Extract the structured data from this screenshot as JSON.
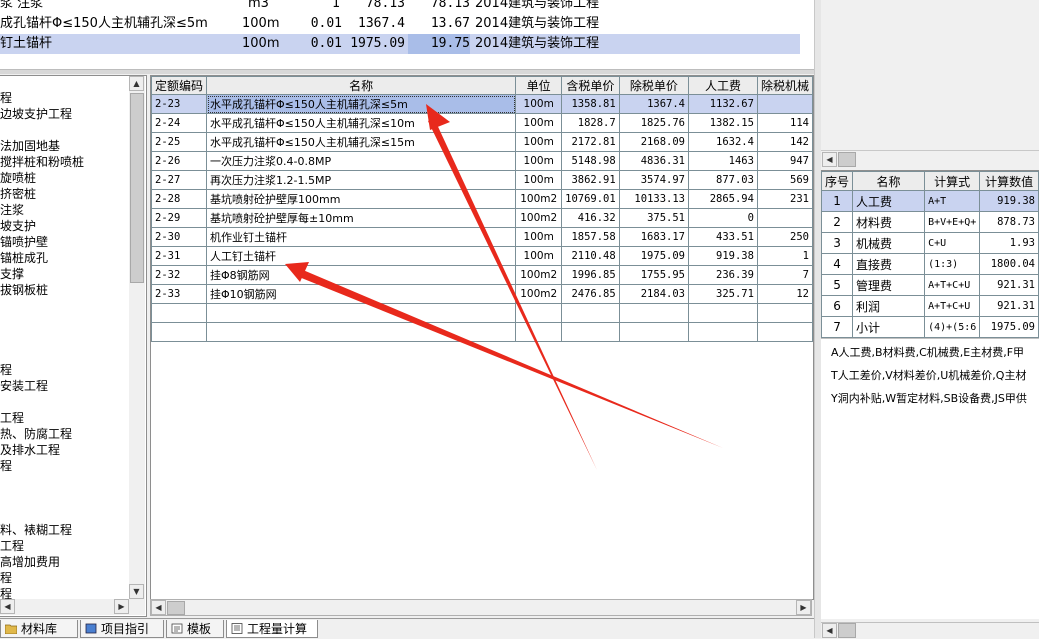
{
  "top_rows": [
    {
      "name": "浆 注浆",
      "unit": "m3",
      "qty": "1",
      "unit_price": "78.13",
      "total": "78.13",
      "profession": "2014建筑与装饰工程"
    },
    {
      "name": "成孔锚杆Φ≤150人主机辅孔深≤5m",
      "unit": "100m",
      "qty": "0.01",
      "unit_price": "1367.4",
      "total": "13.67",
      "profession": "2014建筑与装饰工程"
    },
    {
      "name": "钉土锚杆",
      "unit": "100m",
      "qty": "0.01",
      "unit_price": "1975.09",
      "total": "19.75",
      "profession": "2014建筑与装饰工程"
    }
  ],
  "tree_items": [
    "程",
    "边坡支护工程",
    "",
    "法加固地基",
    "搅拌桩和粉喷桩",
    "旋喷桩",
    "挤密桩",
    "注浆",
    "坡支护",
    "锚喷护壁",
    "锚桩成孔",
    "支撑",
    "拔钢板桩",
    "",
    "",
    "",
    "",
    "程",
    "安装工程",
    "",
    "工程",
    "热、防腐工程",
    "及排水工程",
    "程",
    "",
    "",
    "",
    "料、裱糊工程",
    "工程",
    "高增加费用",
    "程",
    "程"
  ],
  "main_grid": {
    "headers": [
      "定额编码",
      "名称",
      "单位",
      "含税单价",
      "除税单价",
      "人工费",
      "除税机械"
    ],
    "rows": [
      {
        "code": "2-23",
        "name": "水平成孔锚杆Φ≤150人主机辅孔深≤5m",
        "unit": "100m",
        "tax_price": "1358.81",
        "price": "1367.4",
        "labor": "1132.67",
        "machine": ""
      },
      {
        "code": "2-24",
        "name": "水平成孔锚杆Φ≤150人主机辅孔深≤10m",
        "unit": "100m",
        "tax_price": "1828.7",
        "price": "1825.76",
        "labor": "1382.15",
        "machine": "114"
      },
      {
        "code": "2-25",
        "name": "水平成孔锚杆Φ≤150人主机辅孔深≤15m",
        "unit": "100m",
        "tax_price": "2172.81",
        "price": "2168.09",
        "labor": "1632.4",
        "machine": "142"
      },
      {
        "code": "2-26",
        "name": "一次压力注浆0.4-0.8MP",
        "unit": "100m",
        "tax_price": "5148.98",
        "price": "4836.31",
        "labor": "1463",
        "machine": "947"
      },
      {
        "code": "2-27",
        "name": "再次压力注浆1.2-1.5MP",
        "unit": "100m",
        "tax_price": "3862.91",
        "price": "3574.97",
        "labor": "877.03",
        "machine": "569"
      },
      {
        "code": "2-28",
        "name": "基坑喷射砼护壁厚100mm",
        "unit": "100m2",
        "tax_price": "10769.01",
        "price": "10133.13",
        "labor": "2865.94",
        "machine": "231"
      },
      {
        "code": "2-29",
        "name": "基坑喷射砼护壁厚每±10mm",
        "unit": "100m2",
        "tax_price": "416.32",
        "price": "375.51",
        "labor": "0",
        "machine": ""
      },
      {
        "code": "2-30",
        "name": "机作业钉土锚杆",
        "unit": "100m",
        "tax_price": "1857.58",
        "price": "1683.17",
        "labor": "433.51",
        "machine": "250"
      },
      {
        "code": "2-31",
        "name": "人工钉土锚杆",
        "unit": "100m",
        "tax_price": "2110.48",
        "price": "1975.09",
        "labor": "919.38",
        "machine": "1"
      },
      {
        "code": "2-32",
        "name": "挂Φ8钢筋网",
        "unit": "100m2",
        "tax_price": "1996.85",
        "price": "1755.95",
        "labor": "236.39",
        "machine": "7"
      },
      {
        "code": "2-33",
        "name": "挂Φ10钢筋网",
        "unit": "100m2",
        "tax_price": "2476.85",
        "price": "2184.03",
        "labor": "325.71",
        "machine": "12"
      }
    ]
  },
  "bottom_tabs": [
    {
      "label": "材料库",
      "icon": "folder-icon"
    },
    {
      "label": "项目指引",
      "icon": "book-icon"
    },
    {
      "label": "模板",
      "icon": "template-icon"
    },
    {
      "label": "工程量计算",
      "icon": "calculator-icon"
    }
  ],
  "fee_grid": {
    "headers": [
      "序号",
      "名称",
      "计算式",
      "计算数值"
    ],
    "rows": [
      {
        "no": "1",
        "name": "人工费",
        "formula": "A+T",
        "value": "919.38"
      },
      {
        "no": "2",
        "name": "材料费",
        "formula": "B+V+E+Q+",
        "value": "878.73"
      },
      {
        "no": "3",
        "name": "机械费",
        "formula": "C+U",
        "value": "1.93"
      },
      {
        "no": "4",
        "name": "直接费",
        "formula": "(1:3)",
        "value": "1800.04"
      },
      {
        "no": "5",
        "name": "管理费",
        "formula": "A+T+C+U",
        "value": "921.31"
      },
      {
        "no": "6",
        "name": "利润",
        "formula": "A+T+C+U",
        "value": "921.31"
      },
      {
        "no": "7",
        "name": "小计",
        "formula": "(4)+(5:6",
        "value": "1975.09"
      }
    ]
  },
  "legend_lines": [
    "A人工费,B材料费,C机械费,E主材费,F甲",
    "T人工差价,V材料差价,U机械差价,Q主材",
    "Y洞内补贴,W暂定材料,SB设备费,JS甲供"
  ],
  "colors": {
    "selection": "#c9d3f0",
    "selection_strong": "#a9bde8",
    "grid_line": "#7b8f97",
    "arrow": "#e8291c"
  }
}
